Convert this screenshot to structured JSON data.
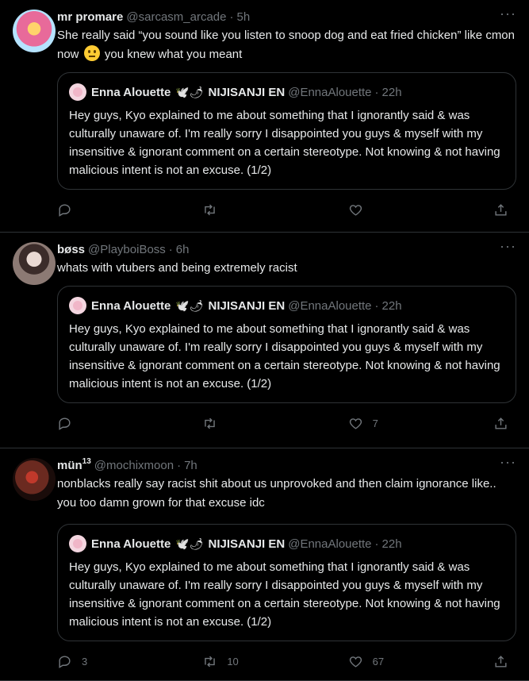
{
  "tweets": [
    {
      "name": "mr promare",
      "name_sup": "",
      "handle": "@sarcasm_arcade",
      "time": "5h",
      "text_a": "She really said “you sound like you listen to snoop dog and eat fried chicken” like cmon now",
      "text_b": "you knew what you meant",
      "avatar_color": "#e86a9a",
      "quote": {
        "name": "Enna Alouette",
        "emoji": "🕊️🌶",
        "org": "NIJISANJI EN",
        "handle": "@EnnaAlouette",
        "time": "22h",
        "text": "Hey guys, Kyo explained to me about something that I ignorantly said & was culturally unaware of. I'm really sorry I disappointed you guys & myself with my insensitive & ignorant comment on a certain stereotype. Not knowing & not having malicious intent is not an excuse. (1/2)"
      },
      "replies": "",
      "retweets": "",
      "likes": ""
    },
    {
      "name": "bøss",
      "name_sup": "",
      "handle": "@PlayboiBoss",
      "time": "6h",
      "text_a": "whats with vtubers and being extremely racist",
      "text_b": "",
      "avatar_color": "#8c7a74",
      "quote": {
        "name": "Enna Alouette",
        "emoji": "🕊️🌶",
        "org": "NIJISANJI EN",
        "handle": "@EnnaAlouette",
        "time": "22h",
        "text": "Hey guys, Kyo explained to me about something that I ignorantly said & was culturally unaware of. I'm really sorry I disappointed you guys & myself with my insensitive & ignorant comment on a certain stereotype. Not knowing & not having malicious intent is not an excuse. (1/2)"
      },
      "replies": "",
      "retweets": "",
      "likes": "7"
    },
    {
      "name": "mün",
      "name_sup": "13",
      "handle": "@mochixmoon",
      "time": "7h",
      "text_a": "nonblacks really say racist shit about us unprovoked and then claim ignorance like.. you too damn grown for that excuse idc",
      "text_b": "",
      "avatar_color": "#6b2a20",
      "quote": {
        "name": "Enna Alouette",
        "emoji": "🕊️🌶",
        "org": "NIJISANJI EN",
        "handle": "@EnnaAlouette",
        "time": "22h",
        "text": "Hey guys, Kyo explained to me about something that I ignorantly said & was culturally unaware of. I'm really sorry I disappointed you guys & myself with my insensitive & ignorant comment on a certain stereotype. Not knowing & not having malicious intent is not an excuse. (1/2)"
      },
      "replies": "3",
      "retweets": "10",
      "likes": "67"
    }
  ],
  "icons": {
    "reply": "reply-icon",
    "retweet": "retweet-icon",
    "like": "heart-icon",
    "share": "share-icon",
    "more": "more-icon"
  }
}
